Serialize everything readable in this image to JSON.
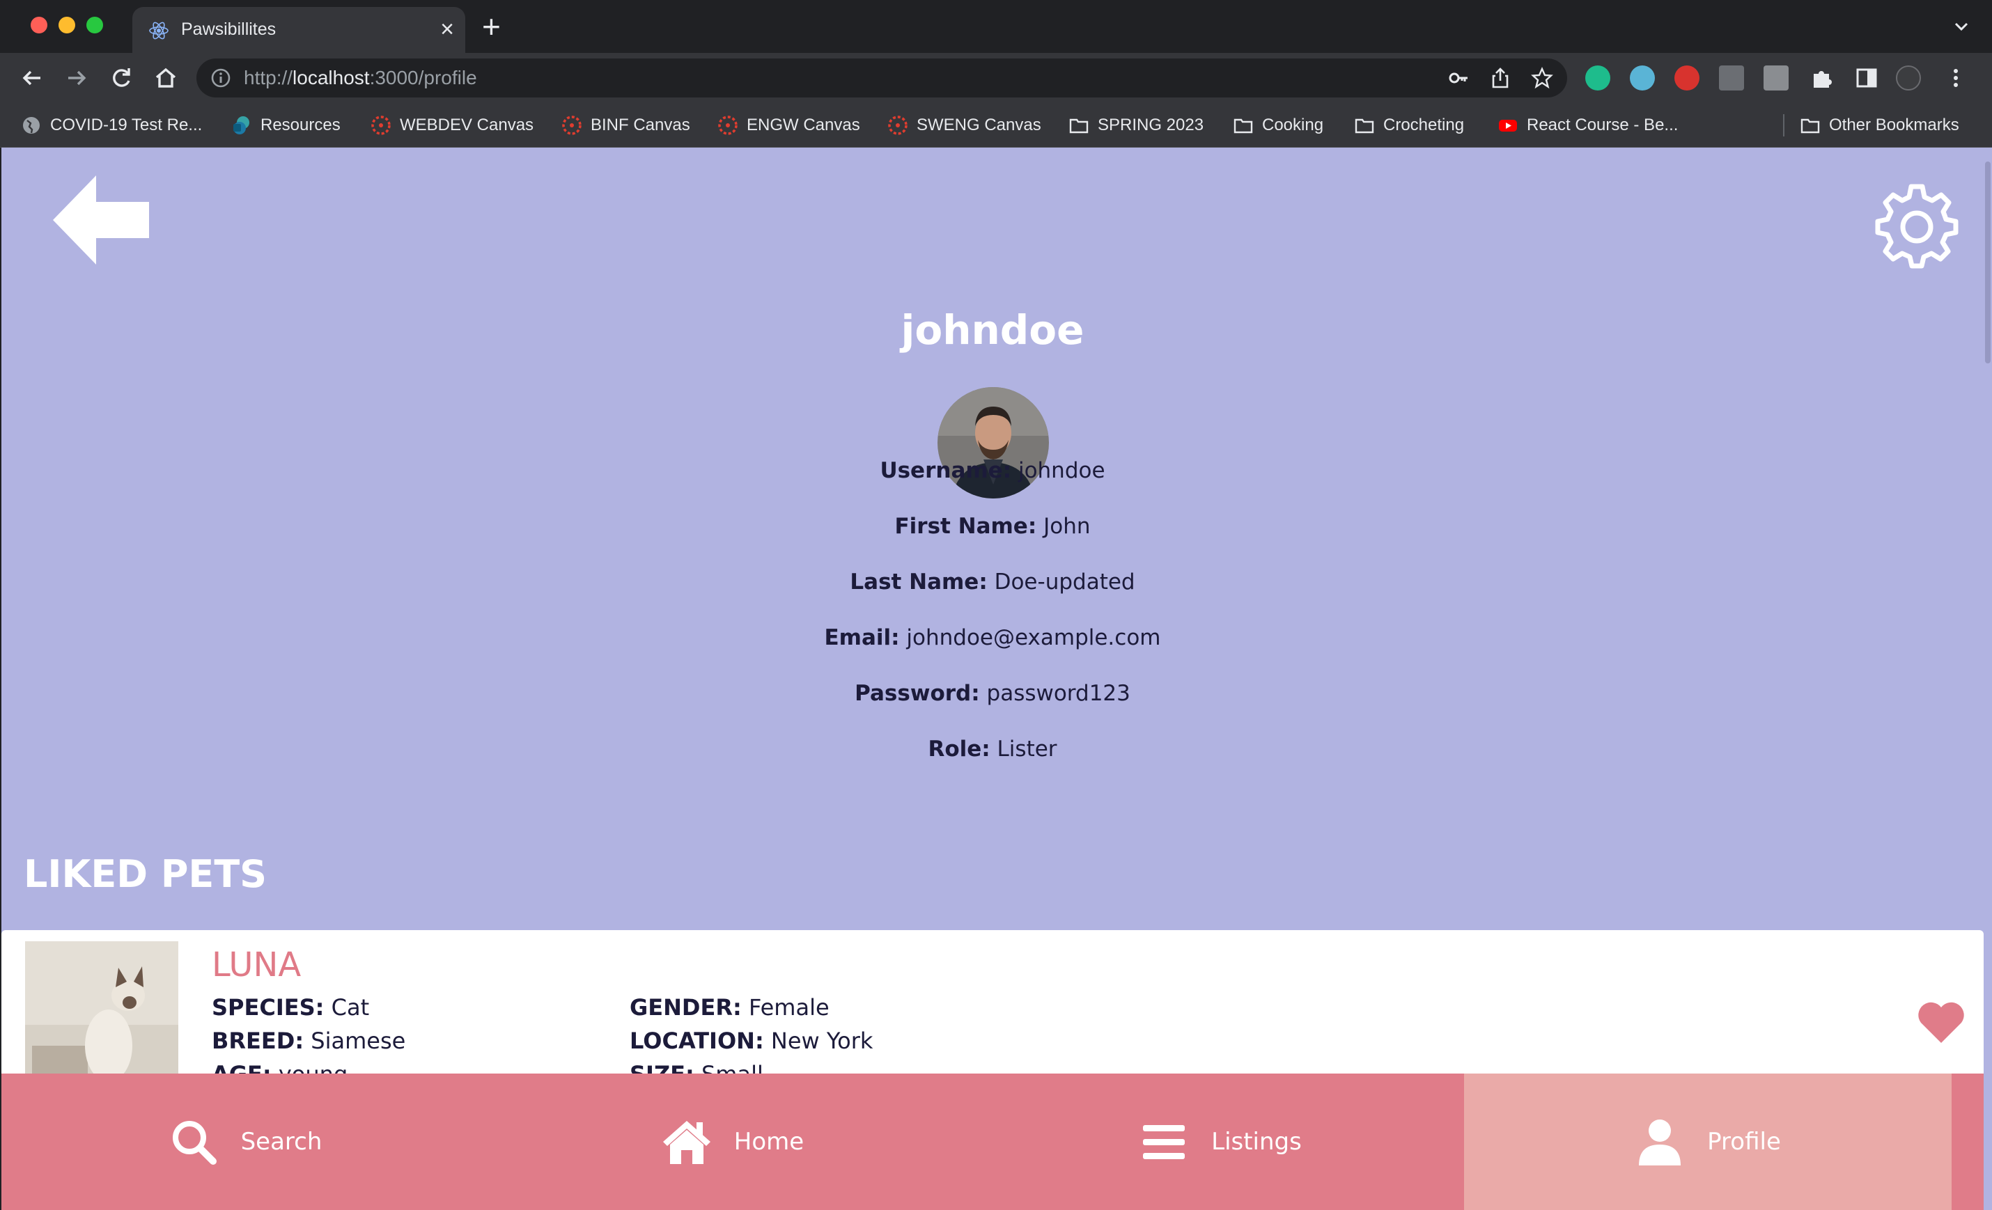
{
  "browser": {
    "tab_title": "Pawsibillites",
    "url_scheme": "http://",
    "url_host": "localhost",
    "url_rest": ":3000/profile",
    "bookmarks": [
      {
        "label": "COVID-19 Test Re...",
        "icon": "globe-icon"
      },
      {
        "label": "Resources",
        "icon": "sharepoint-icon"
      },
      {
        "label": "WEBDEV Canvas",
        "icon": "canvas-icon"
      },
      {
        "label": "BINF Canvas",
        "icon": "canvas-icon"
      },
      {
        "label": "ENGW Canvas",
        "icon": "canvas-icon"
      },
      {
        "label": "SWENG Canvas",
        "icon": "canvas-icon"
      },
      {
        "label": "SPRING 2023",
        "icon": "folder-icon"
      },
      {
        "label": "Cooking",
        "icon": "folder-icon"
      },
      {
        "label": "Crocheting",
        "icon": "folder-icon"
      },
      {
        "label": "React Course - Be...",
        "icon": "youtube-icon"
      }
    ],
    "other_bookmarks": "Other Bookmarks"
  },
  "profile": {
    "title": "johndoe",
    "fields": [
      {
        "label": "Username:",
        "value": "johndoe"
      },
      {
        "label": "First Name:",
        "value": "John"
      },
      {
        "label": "Last Name:",
        "value": "Doe-updated"
      },
      {
        "label": "Email:",
        "value": "johndoe@example.com"
      },
      {
        "label": "Password:",
        "value": "password123"
      },
      {
        "label": "Role:",
        "value": "Lister"
      }
    ]
  },
  "liked": {
    "heading": "LIKED PETS",
    "pet": {
      "name": "LUNA",
      "species_label": "SPECIES:",
      "species": "Cat",
      "breed_label": "BREED:",
      "breed": "Siamese",
      "age_label": "AGE:",
      "age": "young",
      "gender_label": "GENDER:",
      "gender": "Female",
      "location_label": "LOCATION:",
      "location": "New York",
      "size_label": "SIZE:",
      "size": "Small"
    }
  },
  "nav": {
    "search": "Search",
    "home": "Home",
    "listings": "Listings",
    "profile": "Profile",
    "active": "profile"
  },
  "colors": {
    "page_bg": "#b1b3e1",
    "accent": "#e07c89",
    "active_nav": "#eaaaa8",
    "pet_name": "#e07a87"
  }
}
